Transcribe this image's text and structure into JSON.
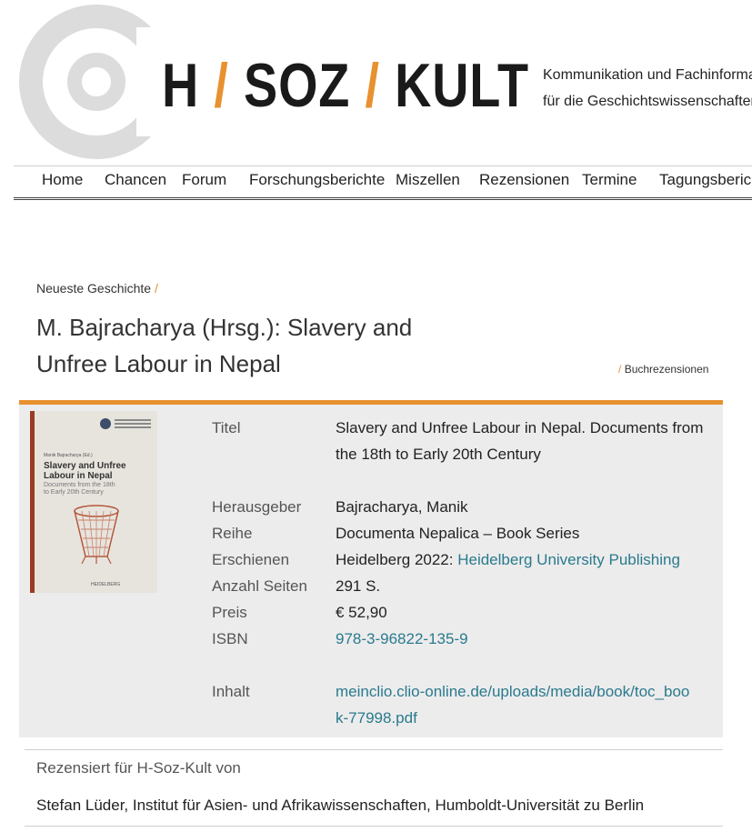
{
  "header": {
    "logo": {
      "part1": "H",
      "slash": "/",
      "part2": "SOZ",
      "part3": "KULT"
    },
    "tagline_line1": "Kommunikation und Fachinforma",
    "tagline_line2": "für die Geschichtswissenschaften"
  },
  "nav": {
    "items": [
      "Home",
      "Chancen",
      "Forum",
      "Forschungsberichte",
      "Miszellen",
      "Rezensionen",
      "Termine",
      "Tagungsbericht"
    ]
  },
  "breadcrumb": {
    "label": "Neueste Geschichte",
    "separator": "/"
  },
  "title_line1": "M. Bajracharya (Hrsg.): Slavery and",
  "title_line2": "Unfree Labour in Nepal",
  "category": {
    "separator": "/",
    "label": "Buchrezensionen"
  },
  "book_cover": {
    "editor": "Manik Bajracharya (Ed.)",
    "title_line1": "Slavery and Unfree",
    "title_line2": "Labour in Nepal",
    "subtitle_line1": "Documents from the 18th",
    "subtitle_line2": "to Early 20th Century",
    "publisher": "HEIDELBERG"
  },
  "details": {
    "titel_label": "Titel",
    "titel_value": "Slavery and Unfree Labour in Nepal. Documents from the 18th to Early 20th Century",
    "herausgeber_label": "Herausgeber",
    "herausgeber_value": "Bajracharya, Manik",
    "reihe_label": "Reihe",
    "reihe_value": "Documenta Nepalica – Book Series",
    "erschienen_label": "Erschienen",
    "erschienen_value": "Heidelberg 2022:",
    "erschienen_link": "Heidelberg University Publishing",
    "seiten_label": "Anzahl Seiten",
    "seiten_value": "291 S.",
    "preis_label": "Preis",
    "preis_value": "€ 52,90",
    "isbn_label": "ISBN",
    "isbn_value": "978-3-96822-135-9",
    "inhalt_label": "Inhalt",
    "inhalt_link": "meinclio.clio-online.de/uploads/media/book/toc_book-77998.pdf"
  },
  "review": {
    "for_label": "Rezensiert für H-Soz-Kult von",
    "reviewer": "Stefan Lüder, Institut für Asien- und Afrikawissenschaften, Humboldt-Universität zu Berlin"
  },
  "colors": {
    "accent": "#e8912f",
    "link": "#2a7a8e",
    "box_bg": "#ececec"
  }
}
